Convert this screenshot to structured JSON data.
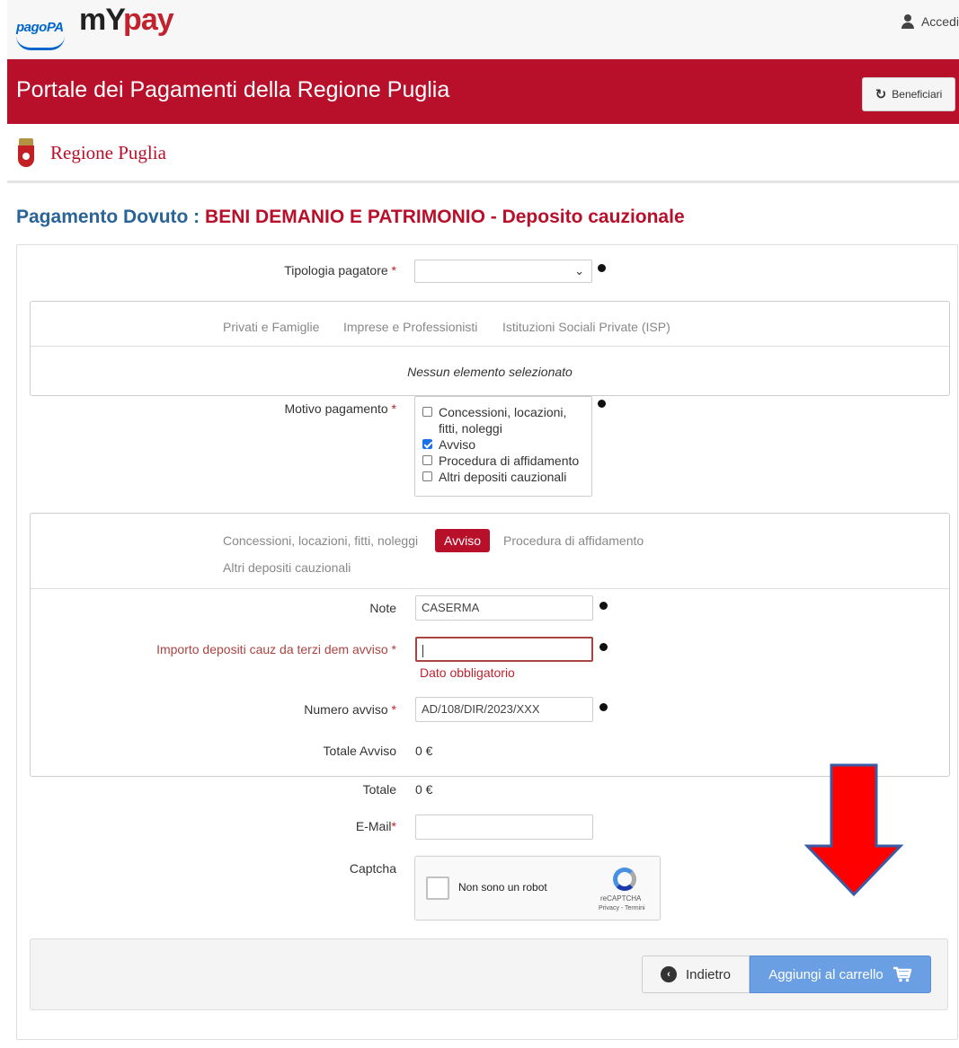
{
  "header": {
    "pagopa_logo": "pagoPA",
    "mypay_logo_my": "mY",
    "mypay_logo_pay": "pay",
    "login_label": "Accedi"
  },
  "portal": {
    "title": "Portale dei Pagamenti della Regione Puglia",
    "beneficiari_label": "Beneficiari"
  },
  "region": {
    "name": "Regione Puglia"
  },
  "page": {
    "title_label": "Pagamento Dovuto :",
    "title_value": "BENI DEMANIO E PATRIMONIO - Deposito cauzionale"
  },
  "form": {
    "tipologia_label": "Tipologia pagatore",
    "required_mark": "*",
    "tipologia_value": "",
    "categories": [
      "Privati e Famiglie",
      "Imprese e Professionisti",
      "Istituzioni Sociali Private (ISP)"
    ],
    "no_selection": "Nessun elemento selezionato",
    "motivo_label": "Motivo pagamento",
    "motivo_options": [
      {
        "label": "Concessioni, locazioni, fitti, noleggi",
        "checked": false
      },
      {
        "label": "Avviso",
        "checked": true
      },
      {
        "label": "Procedura di affidamento",
        "checked": false
      },
      {
        "label": "Altri depositi cauzionali",
        "checked": false
      }
    ],
    "motivo_tabs": [
      "Concessioni, locazioni, fitti, noleggi",
      "Avviso",
      "Procedura di affidamento",
      "Altri depositi cauzionali"
    ],
    "active_tab": "Avviso",
    "note_label": "Note",
    "note_value": "CASERMA",
    "importo_label": "Importo depositi cauz da terzi dem avviso",
    "importo_value": "",
    "importo_error": "Dato obbligatorio",
    "numero_label": "Numero avviso",
    "numero_value": "AD/108/DIR/2023/XXX",
    "totale_avviso_label": "Totale Avviso",
    "totale_avviso_value": "0 €",
    "totale_label": "Totale",
    "totale_value": "0 €",
    "email_label": "E-Mail",
    "email_value": "",
    "captcha_label": "Captcha",
    "captcha_text": "Non sono un robot",
    "recaptcha_name": "reCAPTCHA",
    "recaptcha_terms": "Privacy - Termini"
  },
  "actions": {
    "back_label": "Indietro",
    "add_label": "Aggiungi al carrello"
  },
  "colors": {
    "brand_red": "#b8102a",
    "title_blue": "#2a6496",
    "primary_button": "#6b9fe3",
    "arrow_red": "#ff0000",
    "arrow_outline": "#3b5ba5"
  }
}
